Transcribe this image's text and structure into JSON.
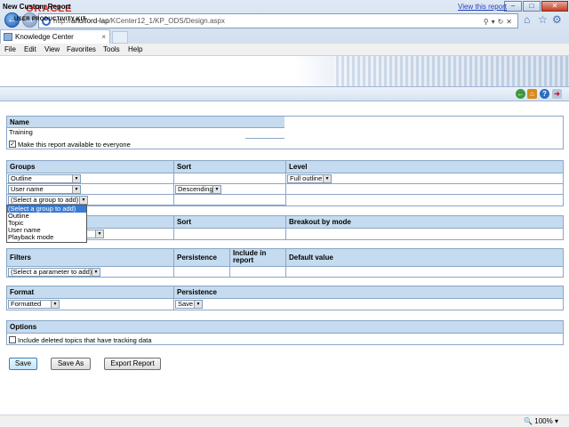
{
  "browser": {
    "url_prefix": "http://",
    "url_host": "ahufford-lap",
    "url_path": "/KCenter12_1/KP_ODS/Design.aspx",
    "tab_title": "Knowledge Center",
    "menus": [
      "File",
      "Edit",
      "View",
      "Favorites",
      "Tools",
      "Help"
    ],
    "zoom": "100%"
  },
  "brand": {
    "logo_text": "ORACLE",
    "product": "USER PRODUCTIVITY KIT"
  },
  "page": {
    "title": "New Custom Report",
    "view_link": "View this report"
  },
  "name_section": {
    "header": "Name",
    "value": "Training",
    "make_available_label": "Make this report available to everyone",
    "make_available_checked": true
  },
  "groups_section": {
    "headers": [
      "Groups",
      "Sort",
      "Level"
    ],
    "row1_group": "Outline",
    "row1_level": "Full outline",
    "row2_group": "User name",
    "row2_sort": "Descending",
    "row3_group": "(Select a group to add)",
    "dropdown_options": [
      "(Select a group to add)",
      "Outline",
      "Topic",
      "User name",
      "Playback mode"
    ],
    "dropdown_highlighted_index": 0
  },
  "breakout_section": {
    "headers": [
      "Sort",
      "Breakout by mode"
    ]
  },
  "filters_section": {
    "headers": [
      "Filters",
      "Persistence",
      "Include in report",
      "Default value"
    ],
    "param_select": "(Select a parameter to add)"
  },
  "format_section": {
    "headers": [
      "Format",
      "Persistence"
    ],
    "format_value": "Formatted",
    "persistence_value": "Save"
  },
  "options_section": {
    "header": "Options",
    "include_deleted_label": "Include deleted topics that have tracking data",
    "include_deleted_checked": false
  },
  "buttons": {
    "save": "Save",
    "save_as": "Save As",
    "export": "Export Report"
  },
  "colors": {
    "header_bg": "#c5dbef",
    "border": "#8aa6c8",
    "link": "#1f3fb8",
    "oracle_red": "#e2231a"
  }
}
